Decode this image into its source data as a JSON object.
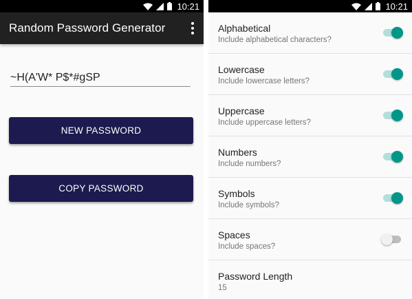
{
  "status_bar": {
    "time": "10:21"
  },
  "left_screen": {
    "app_title": "Random Password Generator",
    "password_value": "~H(A'W* P$*#gSP",
    "new_password_label": "NEW PASSWORD",
    "copy_password_label": "COPY PASSWORD"
  },
  "settings": {
    "items": [
      {
        "title": "Alphabetical",
        "summary": "Include alphabetical characters?",
        "enabled": true
      },
      {
        "title": "Lowercase",
        "summary": "Include lowercase letters?",
        "enabled": true
      },
      {
        "title": "Uppercase",
        "summary": "Include uppercase letters?",
        "enabled": true
      },
      {
        "title": "Numbers",
        "summary": "Include numbers?",
        "enabled": true
      },
      {
        "title": "Symbols",
        "summary": "Include symbols?",
        "enabled": true
      },
      {
        "title": "Spaces",
        "summary": "Include spaces?",
        "enabled": false
      }
    ],
    "password_length": {
      "title": "Password Length",
      "value": "15"
    }
  },
  "colors": {
    "app_bar": "#212121",
    "button": "#1c1a4e",
    "switch_on": "#009688",
    "switch_track_on": "#b2dfdb"
  },
  "icons": [
    "wifi-icon",
    "signal-icon",
    "battery-icon",
    "overflow-menu-icon"
  ]
}
